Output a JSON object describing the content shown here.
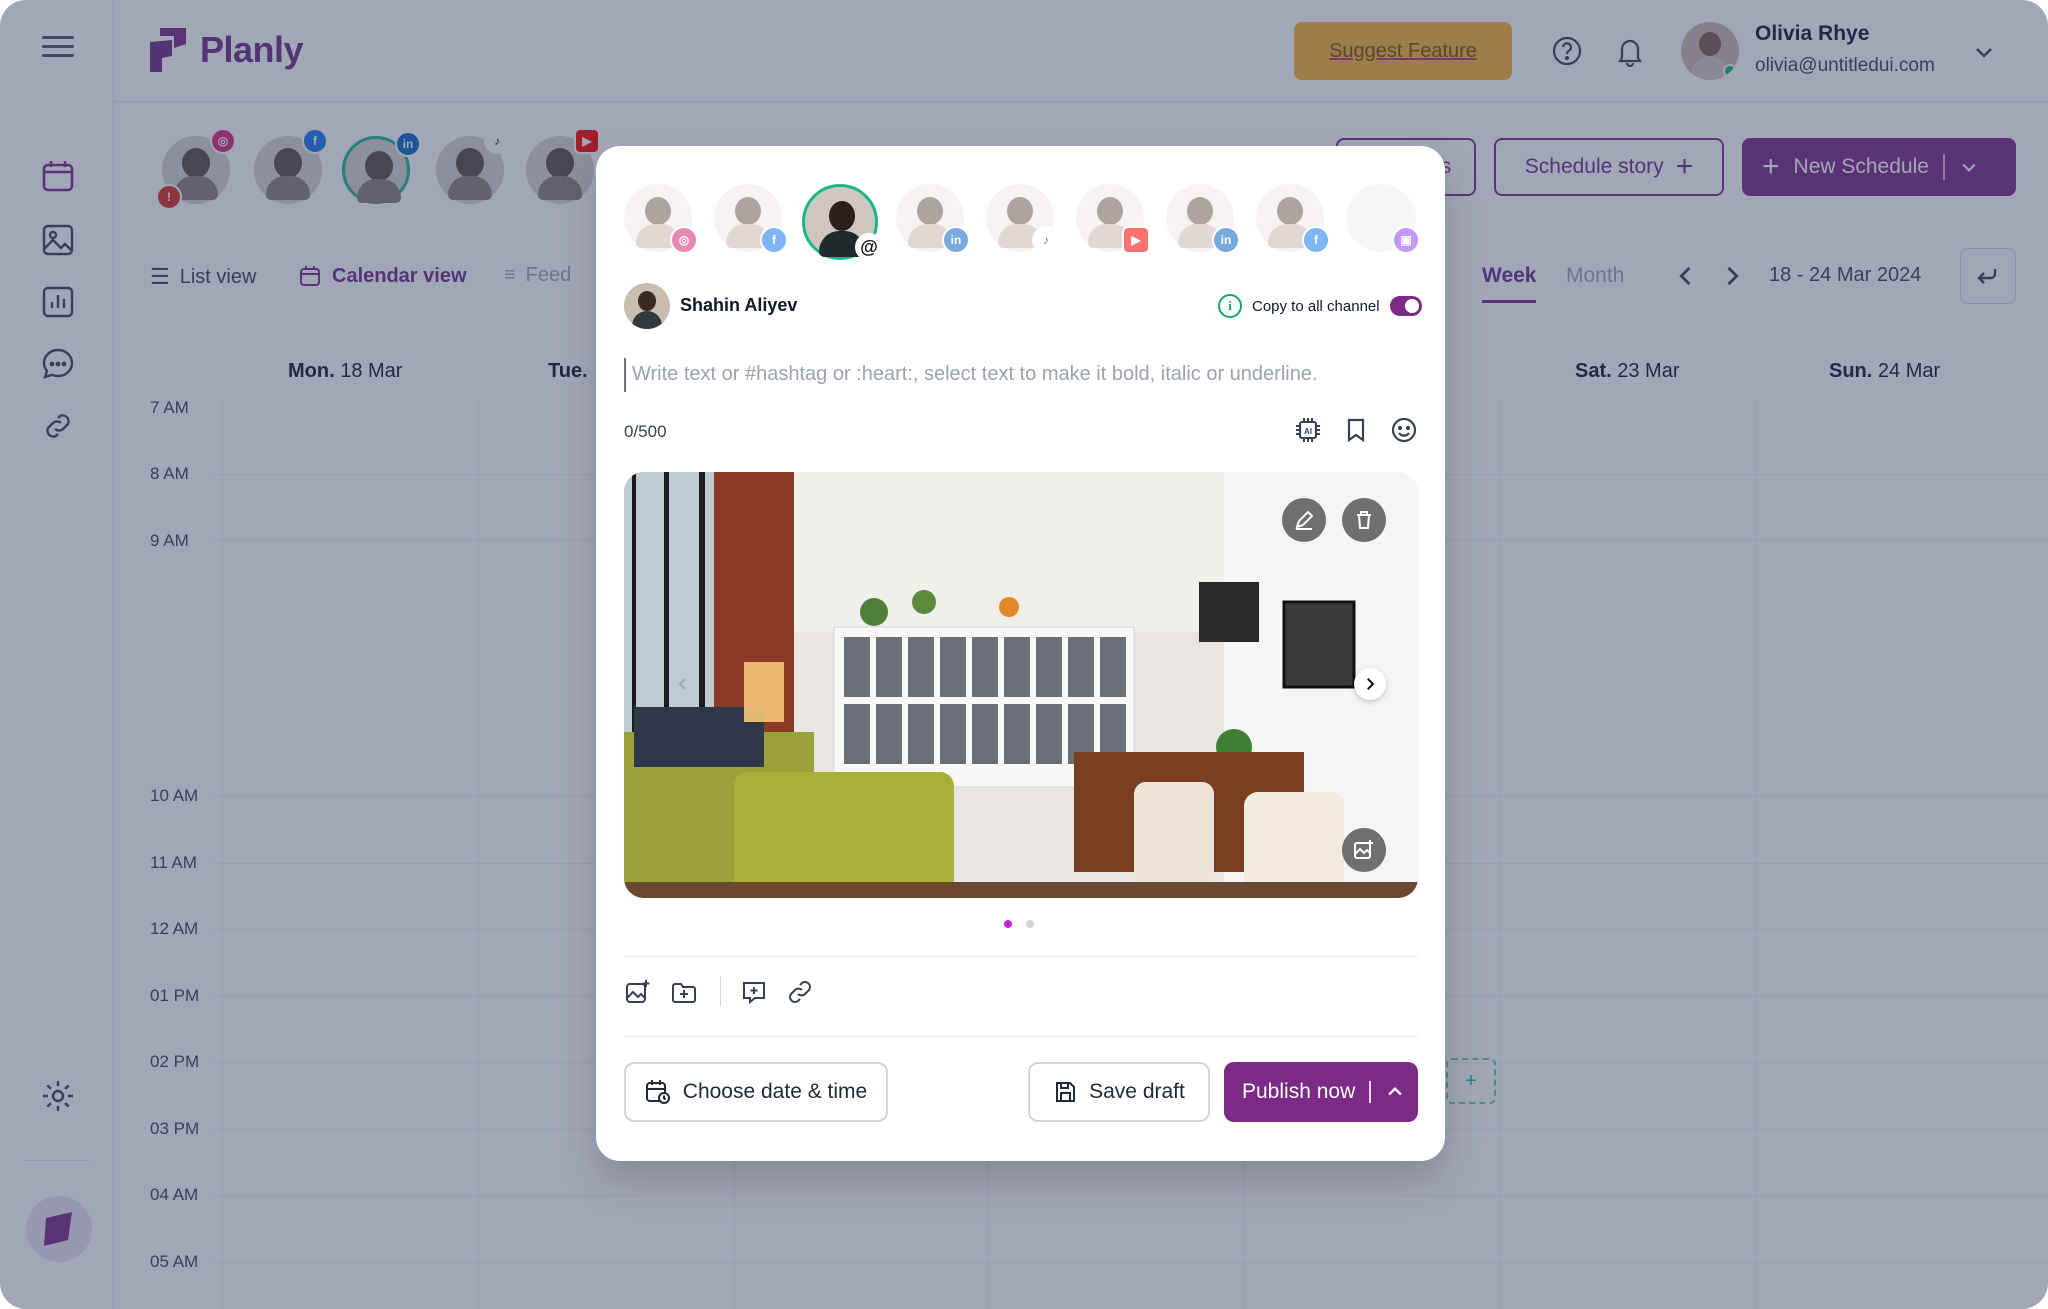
{
  "app": {
    "brand": "Planly",
    "suggest_feature": "Suggest Feature",
    "user": {
      "name": "Olivia Rhye",
      "email": "olivia@untitledui.com"
    }
  },
  "toolbar": {
    "schedule_story": "Schedule story",
    "new_schedule": "New Schedule",
    "partial_button": "s"
  },
  "views": {
    "list": "List view",
    "calendar": "Calendar view",
    "feed": "Feed",
    "week": "Week",
    "month": "Month",
    "date_range": "18 - 24 Mar 2024"
  },
  "days": [
    {
      "name": "Mon.",
      "date": "18 Mar"
    },
    {
      "name": "Tue.",
      "date": ""
    },
    {
      "name": "Sat.",
      "date": "23 Mar"
    },
    {
      "name": "Sun.",
      "date": "24 Mar"
    }
  ],
  "hours": [
    "7 AM",
    "8 AM",
    "9 AM",
    "10 AM",
    "11 AM",
    "12 AM",
    "01 PM",
    "02 PM",
    "03 PM",
    "04 AM",
    "05 AM"
  ],
  "modal": {
    "author": "Shahin Aliyev",
    "copy_label": "Copy to all channel",
    "copy_enabled": true,
    "placeholder": "Write text or #hashtag or :heart:, select text to make it bold, italic or underline.",
    "counter": "0/500",
    "ai_label": "AI",
    "choose_date": "Choose date & time",
    "save_draft": "Save draft",
    "publish": "Publish now",
    "active_slide": 1,
    "slide_count": 2
  },
  "channels": [
    "instagram",
    "facebook",
    "threads",
    "linkedin",
    "tiktok",
    "youtube",
    "linkedin",
    "facebook",
    "twitch"
  ],
  "colors": {
    "primary": "#7b2a86",
    "accent_yellow": "#f5b335",
    "active_ring": "#18b88a",
    "overlay": "#344064"
  }
}
